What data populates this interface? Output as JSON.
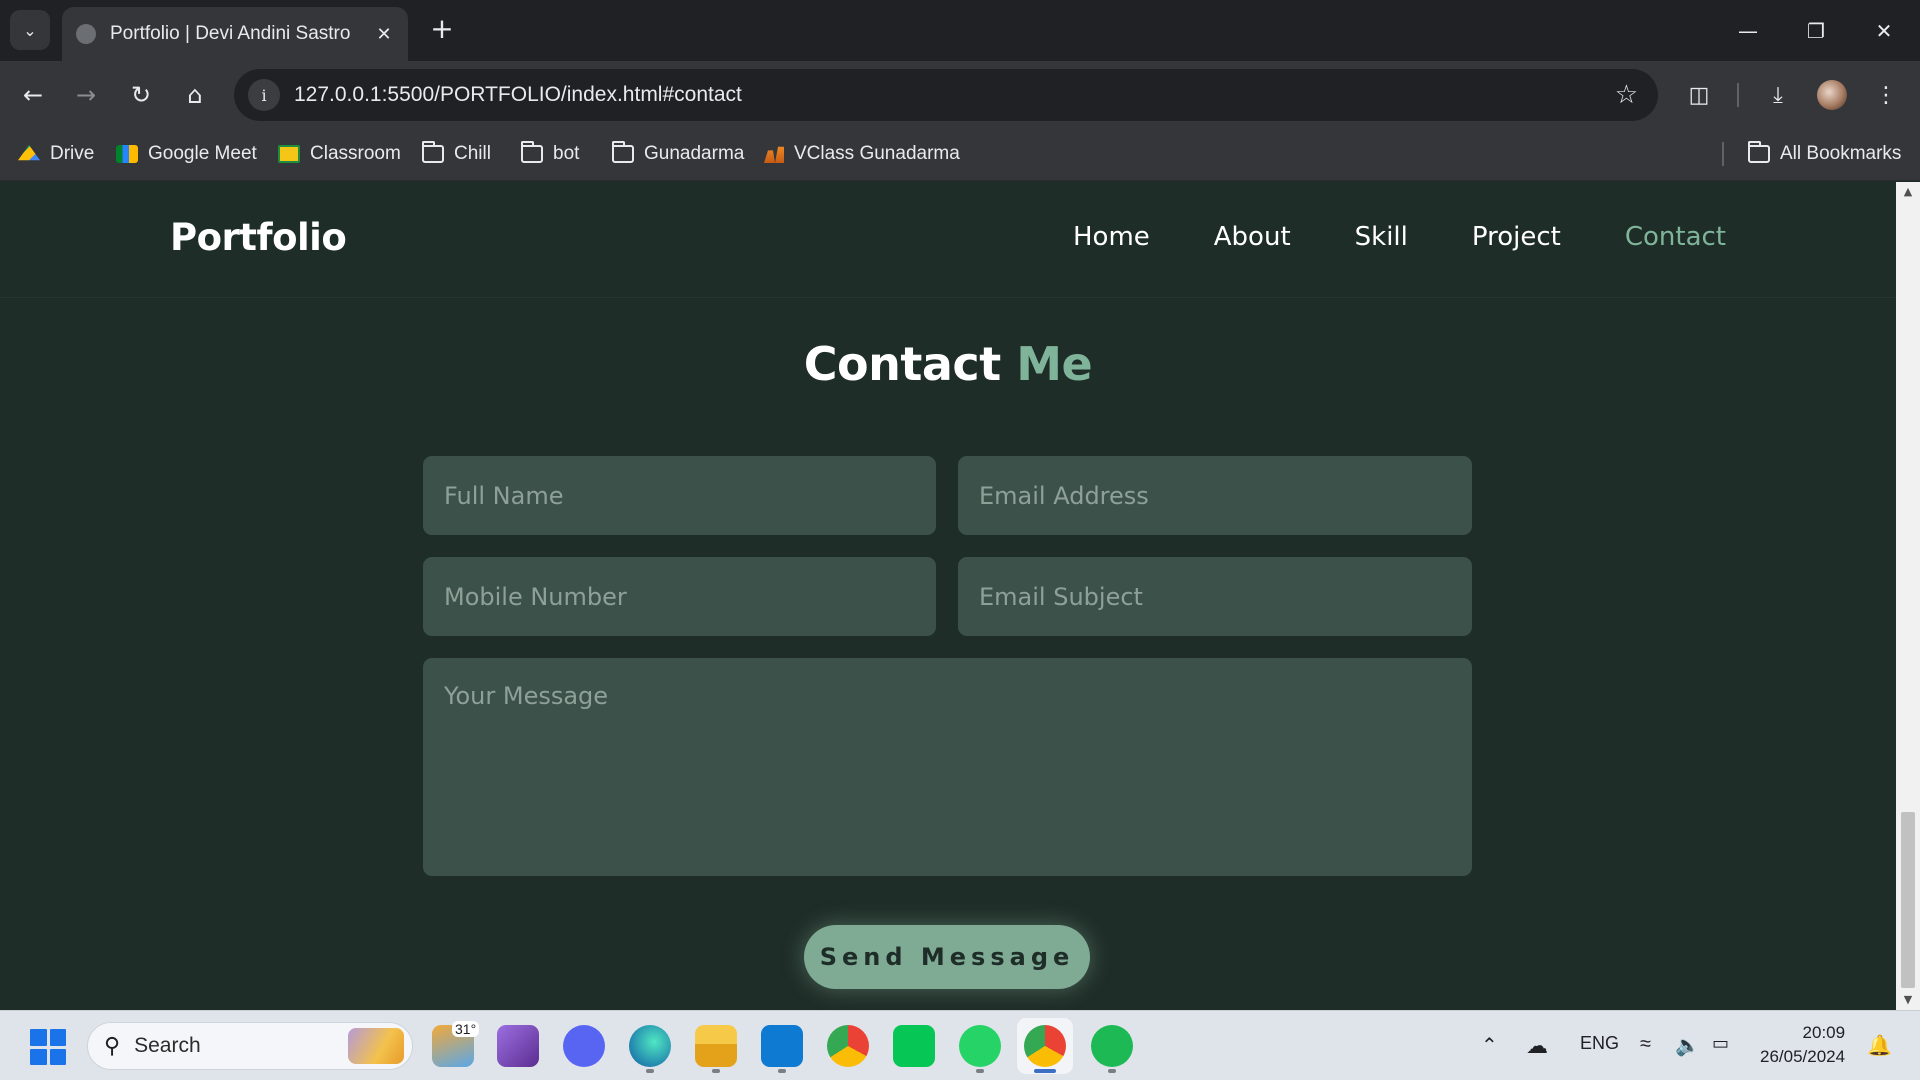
{
  "browser": {
    "tab_title": "Portfolio | Devi Andini Sastro",
    "url": "127.0.0.1:5500/PORTFOLIO/index.html#contact",
    "bookmarks": [
      {
        "label": "Drive",
        "icon": "google-drive-icon"
      },
      {
        "label": "Google Meet",
        "icon": "google-meet-icon"
      },
      {
        "label": "Classroom",
        "icon": "google-classroom-icon"
      },
      {
        "label": "Chill",
        "icon": "folder-icon"
      },
      {
        "label": "bot",
        "icon": "folder-icon"
      },
      {
        "label": "Gunadarma",
        "icon": "folder-icon"
      },
      {
        "label": "VClass Gunadarma",
        "icon": "vclass-icon"
      }
    ],
    "all_bookmarks_label": "All Bookmarks"
  },
  "site": {
    "logo": "Portfolio",
    "nav": [
      "Home",
      "About",
      "Skill",
      "Project",
      "Contact"
    ],
    "active_nav": "Contact",
    "accent_color": "#7fb49b",
    "background_color": "#1f2d28"
  },
  "contact": {
    "title_main": "Contact",
    "title_accent": "Me",
    "placeholders": {
      "full_name": "Full Name",
      "email": "Email Address",
      "mobile": "Mobile Number",
      "subject": "Email Subject",
      "message": "Your Message"
    },
    "submit_label": "Send Message"
  },
  "taskbar": {
    "search_label": "Search",
    "weather_temp": "31°",
    "language": "ENG",
    "time": "20:09",
    "date": "26/05/2024",
    "apps": [
      "weather-icon",
      "visual-studio-icon",
      "discord-icon",
      "edge-icon",
      "file-explorer-icon",
      "vscode-icon",
      "chrome-icon",
      "line-icon",
      "whatsapp-icon",
      "chrome-profile-icon",
      "spotify-icon"
    ]
  }
}
